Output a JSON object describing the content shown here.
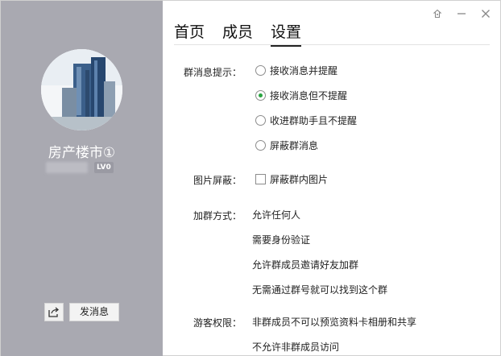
{
  "profile": {
    "group_name": "房产楼市①",
    "level": "LV0"
  },
  "actions": {
    "send_message": "发消息"
  },
  "tabs": [
    {
      "label": "首页"
    },
    {
      "label": "成员"
    },
    {
      "label": "设置",
      "active": true
    }
  ],
  "settings": {
    "notify": {
      "label": "群消息提示：",
      "options": [
        {
          "label": "接收消息并提醒",
          "checked": false
        },
        {
          "label": "接收消息但不提醒",
          "checked": true
        },
        {
          "label": "收进群助手且不提醒",
          "checked": false
        },
        {
          "label": "屏蔽群消息",
          "checked": false
        }
      ]
    },
    "image_block": {
      "label": "图片屏蔽：",
      "option": "屏蔽群内图片",
      "checked": false
    },
    "join_method": {
      "label": "加群方式：",
      "options": [
        "允许任何人",
        "需要身份验证",
        "允许群成员邀请好友加群",
        "无需通过群号就可以找到这个群"
      ]
    },
    "guest_rights": {
      "label": "游客权限：",
      "options": [
        "非群成员不可以预览资料卡相册和共享",
        "不允许非群成员访问"
      ]
    }
  },
  "colors": {
    "left_panel": "#a9a9b1",
    "radio_checked": "#2aa441"
  }
}
